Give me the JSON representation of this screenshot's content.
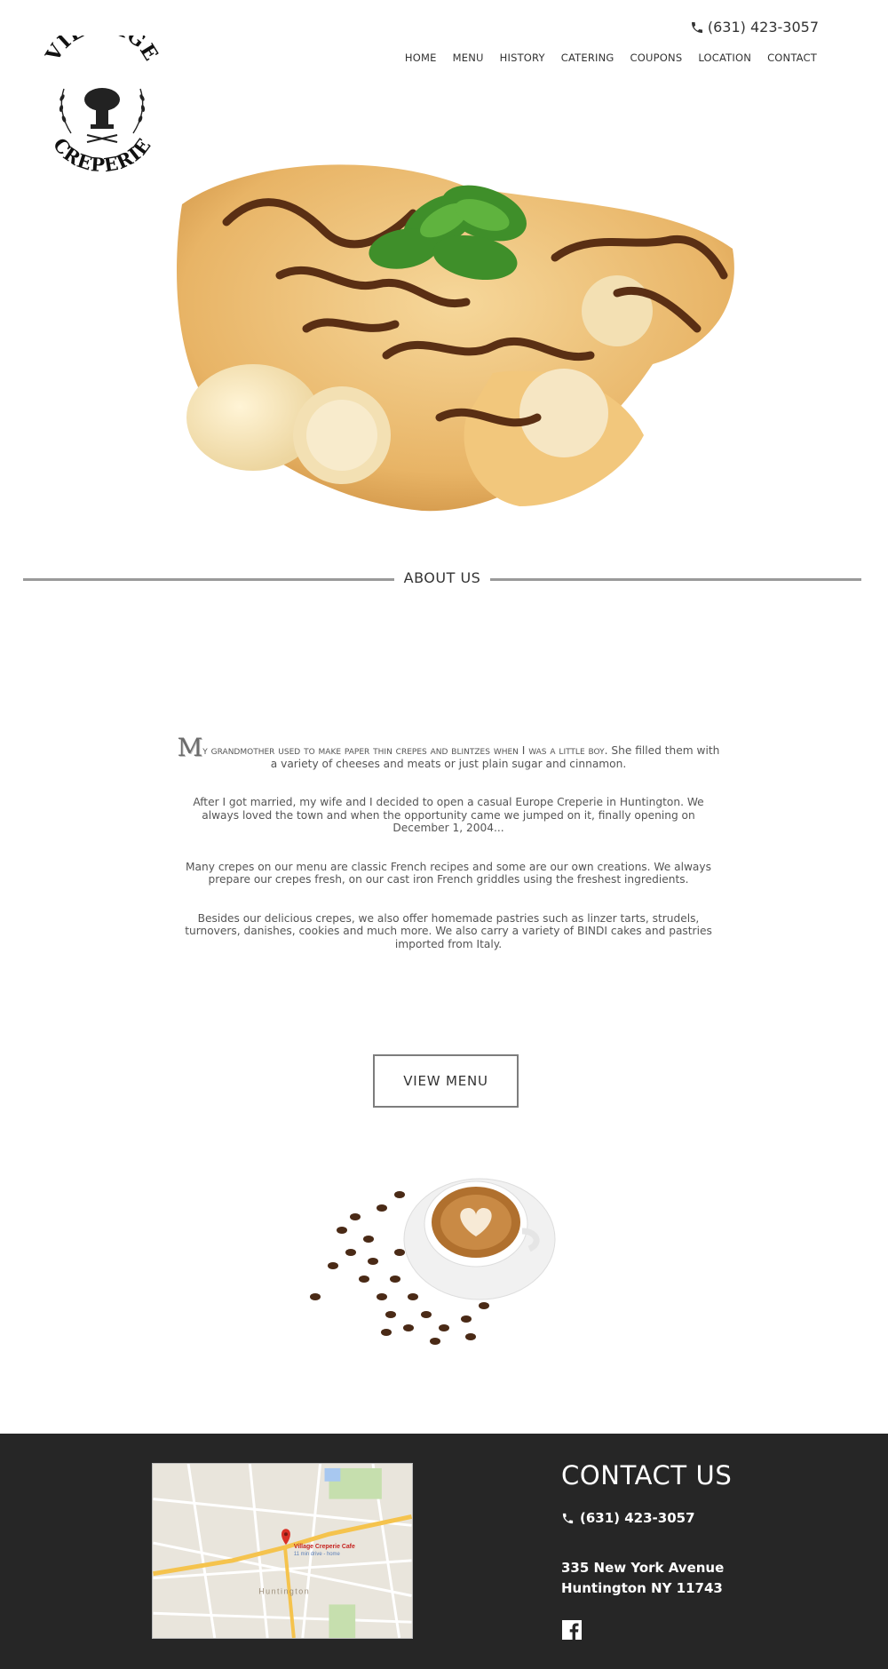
{
  "header": {
    "phone": "(631) 423-3057",
    "nav": [
      "HOME",
      "MENU",
      "HISTORY",
      "CATERING",
      "COUPONS",
      "LOCATION",
      "CONTACT"
    ],
    "logo_text_top": "VILLIAGE",
    "logo_text_bottom": "CREPERIE"
  },
  "about": {
    "title": "ABOUT US",
    "dropcap": "M",
    "first_smallcaps": "y grandmother used to make paper thin crepes and blintzes when I was a little boy.",
    "first_rest": " She filled them with a variety of cheeses and meats or just plain sugar and cinnamon.",
    "p2": "After I got married, my wife and I decided to open a casual Europe Creperie in Huntington. We always loved the town and when the opportunity came we jumped on it, finally opening on December 1, 2004...",
    "p3": "Many crepes on our menu are classic French recipes and some are our own creations. We always prepare our crepes fresh, on our cast iron French griddles using the freshest ingredients.",
    "p4": "Besides our delicious crepes, we also offer homemade pastries such as linzer tarts, strudels, turnovers, danishes, cookies and much more. We also carry a variety of  BINDI cakes and pastries imported from Italy."
  },
  "cta": {
    "view_menu": "VIEW MENU"
  },
  "footer": {
    "contact_title": "CONTACT US",
    "phone": "(631) 423-3057",
    "address_line1": "335 New York Avenue",
    "address_line2": "Huntington NY 11743",
    "map_label": "Village Creperie Cafe",
    "map_sublabel": "11 min drive - home",
    "map_town": "Huntington"
  },
  "icons": [
    "phone-icon",
    "facebook-icon",
    "map-pin-icon"
  ],
  "colors": {
    "footer_bg": "#262626",
    "rule": "#9a9a9a",
    "map_pin": "#d93025"
  }
}
